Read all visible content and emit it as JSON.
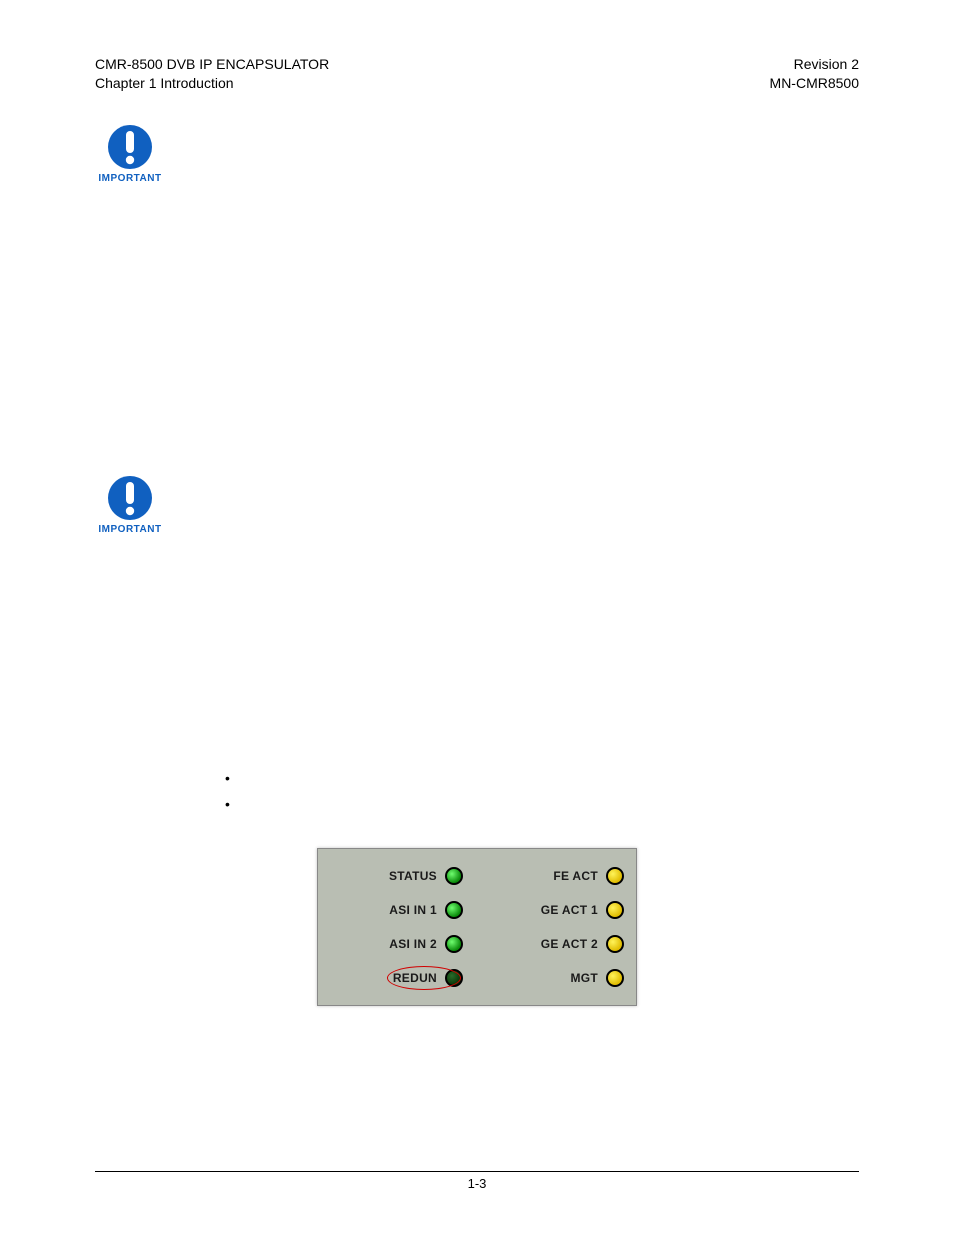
{
  "header": {
    "left_line1": "CMR-8500 DVB IP ENCAPSULATOR",
    "left_line2": "Chapter 1 Introduction",
    "right_line1": "Revision 2",
    "right_line2": "MN-CMR8500"
  },
  "icons": {
    "important_label": "IMPORTANT"
  },
  "bullets": {
    "items": [
      "",
      ""
    ]
  },
  "panel": {
    "left": [
      {
        "label": "STATUS",
        "color": "green"
      },
      {
        "label": "ASI IN 1",
        "color": "green"
      },
      {
        "label": "ASI IN 2",
        "color": "green"
      },
      {
        "label": "REDUN",
        "color": "off",
        "highlight": true
      }
    ],
    "right": [
      {
        "label": "FE ACT",
        "color": "yellow"
      },
      {
        "label": "GE ACT 1",
        "color": "yellow"
      },
      {
        "label": "GE ACT 2",
        "color": "yellow"
      },
      {
        "label": "MGT",
        "color": "yellow"
      }
    ]
  },
  "footer": {
    "page": "1-3"
  }
}
